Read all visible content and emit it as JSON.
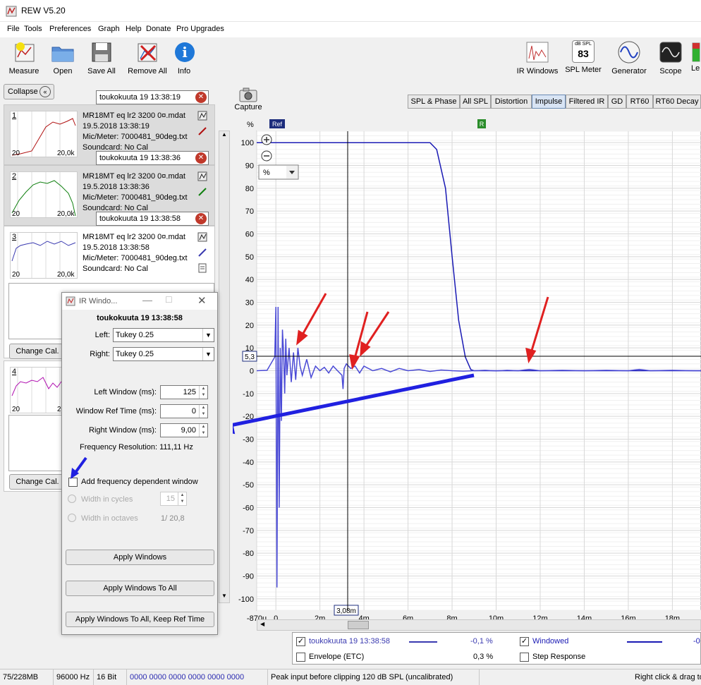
{
  "window": {
    "title": "REW V5.20"
  },
  "menu": [
    "File",
    "Tools",
    "Preferences",
    "Graph",
    "Help",
    "Donate",
    "Pro Upgrades"
  ],
  "toolbar": {
    "left": [
      "Measure",
      "Open",
      "Save All",
      "Remove All",
      "Info"
    ],
    "right": [
      "IR Windows",
      "SPL Meter",
      "Generator",
      "Scope",
      "Le"
    ],
    "spl_meter_unit": "dB SPL",
    "spl_meter_value": "83"
  },
  "panel": {
    "collapse_label": "Collapse",
    "capture_label": "Capture",
    "measurements": [
      {
        "num": "1",
        "name": "toukokuuta 19 13:38:19",
        "file": "MR18MT eq lr2 3200 0¤.mdat",
        "date": "19.5.2018 13:38:19",
        "mic": "Mic/Meter: 7000481_90deg.txt",
        "soundcard": "Soundcard: No Cal",
        "xmin": "20",
        "xmax": "20,0k",
        "color": "#b01010"
      },
      {
        "num": "2",
        "name": "toukokuuta 19 13:38:36",
        "file": "MR18MT eq lr2 3200 0¤.mdat",
        "date": "19.5.2018 13:38:36",
        "mic": "Mic/Meter: 7000481_90deg.txt",
        "soundcard": "Soundcard: No Cal",
        "xmin": "20",
        "xmax": "20,0k",
        "color": "#108010"
      },
      {
        "num": "3",
        "name": "toukokuuta 19 13:38:58",
        "file": "MR18MT eq lr2 3200 0¤.mdat",
        "date": "19.5.2018 13:38:58",
        "mic": "Mic/Meter: 7000481_90deg.txt",
        "soundcard": "Soundcard: No Cal",
        "xmin": "20",
        "xmax": "20,0k",
        "color": "#3a3ab0"
      },
      {
        "num": "4",
        "xmin": "20",
        "xmax": "20,0k",
        "color": "#b010b0"
      }
    ],
    "change_cal_label": "Change Cal."
  },
  "dialog": {
    "title": "IR Windo...",
    "measurement": "toukokuuta 19 13:38:58",
    "left_label": "Left:",
    "left_value": "Tukey 0.25",
    "right_label": "Right:",
    "right_value": "Tukey 0.25",
    "left_window_label": "Left Window (ms):",
    "left_window_value": "125",
    "ref_time_label": "Window Ref Time (ms):",
    "ref_time_value": "0",
    "right_window_label": "Right Window (ms):",
    "right_window_value": "9,00",
    "freq_res_label": "Frequency Resolution:",
    "freq_res_value": "111,11 Hz",
    "fdw_label": "Add frequency dependent window",
    "cycles_label": "Width in cycles",
    "cycles_value": "15",
    "octaves_label": "Width in octaves",
    "octaves_value": "1/ 20,8",
    "btn_apply": "Apply Windows",
    "btn_apply_all": "Apply Windows To All",
    "btn_apply_all_ref": "Apply Windows To All, Keep Ref Time"
  },
  "graph_tabs": [
    "SPL & Phase",
    "All SPL",
    "Distortion",
    "Impulse",
    "Filtered IR",
    "GD",
    "RT60",
    "RT60 Decay"
  ],
  "graph_active_tab": "Impulse",
  "graph": {
    "y_unit_label": "%",
    "scale_select": "%",
    "ref_marker": "Ref",
    "r_marker": "R",
    "cursor_y_value": "5,3",
    "cursor_x_value": "3,08m"
  },
  "chart_data": {
    "type": "line",
    "xlabel": "",
    "ylabel": "%",
    "xlim": [
      -0.87,
      19.3
    ],
    "ylim": [
      -105,
      105
    ],
    "x_ticks": [
      "-870u",
      "0",
      "2m",
      "4m",
      "6m",
      "8m",
      "10m",
      "12m",
      "14m",
      "16m",
      "18m"
    ],
    "x_tick_values": [
      -0.87,
      0,
      2,
      4,
      6,
      8,
      10,
      12,
      14,
      16,
      18
    ],
    "y_ticks": [
      100,
      90,
      80,
      70,
      60,
      50,
      40,
      30,
      20,
      10,
      0,
      -10,
      -20,
      -30,
      -40,
      -50,
      -60,
      -70,
      -80,
      -90,
      -100
    ],
    "grid": true,
    "series": [
      {
        "name": "Windowed",
        "color": "#1a1ab4",
        "x": [
          -0.87,
          7.0,
          7.3,
          7.7,
          8.0,
          8.3,
          8.6,
          8.85,
          9.0,
          19.3
        ],
        "y": [
          100,
          100,
          97,
          80,
          50,
          22,
          6,
          0.5,
          0,
          0
        ]
      },
      {
        "name": "toukokuuta 19 13:38:58",
        "color": "#4a4ad6",
        "x": [
          -0.87,
          -0.4,
          -0.05,
          0.0,
          0.05,
          0.1,
          0.15,
          0.2,
          0.25,
          0.3,
          0.35,
          0.4,
          0.45,
          0.5,
          0.6,
          0.7,
          0.8,
          0.9,
          1.0,
          1.1,
          1.2,
          1.4,
          1.6,
          1.8,
          2.0,
          2.2,
          2.4,
          2.6,
          2.8,
          3.0,
          3.05,
          3.1,
          3.2,
          3.4,
          3.6,
          3.8,
          4.0,
          4.4,
          4.8,
          5.2,
          5.6,
          6.0,
          6.5,
          7.0,
          7.5,
          8.0,
          8.5,
          9.0,
          9.5,
          10.0,
          10.5,
          11.0,
          11.5,
          12.0,
          13.0,
          14.0,
          15.0,
          16.0,
          16.5,
          17.0,
          18.0,
          19.0,
          19.3
        ],
        "y": [
          0,
          0.2,
          6,
          28,
          -95,
          28,
          -60,
          10,
          -22,
          18,
          8,
          -10,
          14,
          -2,
          10,
          -5,
          8,
          -4,
          10,
          2,
          -2,
          5,
          -3,
          2,
          0,
          1.5,
          -1,
          2,
          0,
          -2,
          -8,
          1,
          3,
          1,
          2,
          -1,
          2,
          0,
          1,
          -0.5,
          1,
          0,
          0.5,
          -0.3,
          0.3,
          0,
          -0.2,
          0,
          0.2,
          -0.1,
          0.2,
          0,
          0.6,
          0,
          0.2,
          0,
          0.2,
          0,
          0.6,
          0,
          0.2,
          0,
          0
        ]
      }
    ]
  },
  "legend": {
    "rows": [
      {
        "name": "toukokuuta 19 13:38:58",
        "value": "-0,1 %",
        "checked": true,
        "color": "#3a3ab0"
      },
      {
        "name": "Envelope (ETC)",
        "value": "0,3 %",
        "checked": false,
        "color": ""
      }
    ],
    "right_rows": [
      {
        "name": "Windowed",
        "value": "-0",
        "checked": true,
        "color": "#1a1ab4"
      },
      {
        "name": "Step Response",
        "checked": false
      }
    ]
  },
  "status": {
    "memory": "75/228MB",
    "sample_rate": "96000 Hz",
    "bits": "16 Bit",
    "levels": "0000 0000  0000 0000  0000 0000",
    "peak": "Peak input before clipping 120 dB SPL (uncalibrated)",
    "hint": "Right click & drag to"
  }
}
